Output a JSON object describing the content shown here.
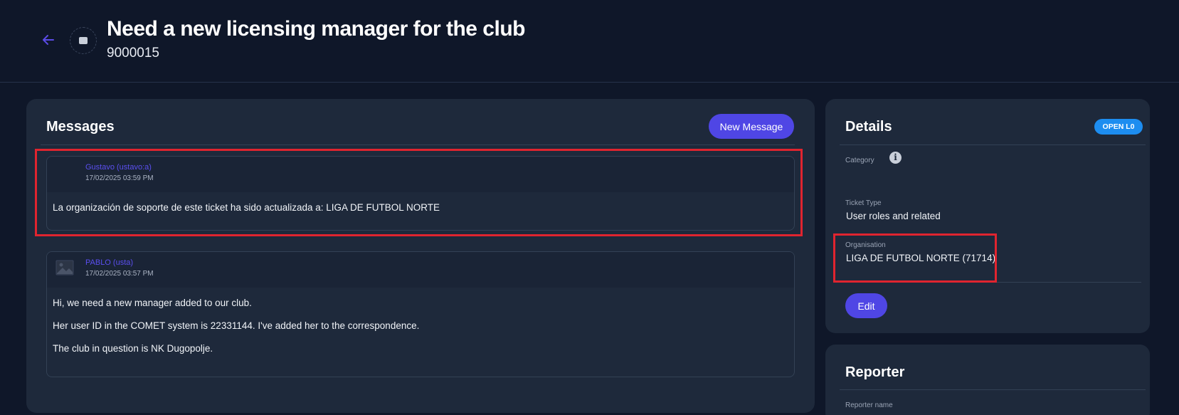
{
  "header": {
    "title": "Need a new licensing manager for the club",
    "ticket_id": "9000015"
  },
  "messages": {
    "title": "Messages",
    "new_message_label": "New Message",
    "items": [
      {
        "author": "Gustavo (ustavo:a)",
        "date": "17/02/2025 03:59 PM",
        "lines": [
          "La organización de soporte de este ticket ha sido actualizada a: LIGA DE FUTBOL NORTE"
        ]
      },
      {
        "author": "PABLO (usta)",
        "date": "17/02/2025 03:57 PM",
        "lines": [
          "Hi, we need a new manager added to our club.",
          "Her user ID in the COMET system is 22331144. I've added her to the correspondence.",
          "The club in question is NK Dugopolje."
        ]
      }
    ]
  },
  "details": {
    "title": "Details",
    "status": "OPEN L0",
    "category_label": "Category",
    "ticket_type_label": "Ticket Type",
    "ticket_type_value": "User roles and related",
    "organisation_label": "Organisation",
    "organisation_value": "LIGA DE FUTBOL NORTE (71714)",
    "edit_label": "Edit"
  },
  "reporter": {
    "title": "Reporter",
    "name_label": "Reporter name"
  },
  "colors": {
    "accent": "#4f46e5",
    "status": "#1d8df0",
    "highlight": "#e0242f"
  }
}
